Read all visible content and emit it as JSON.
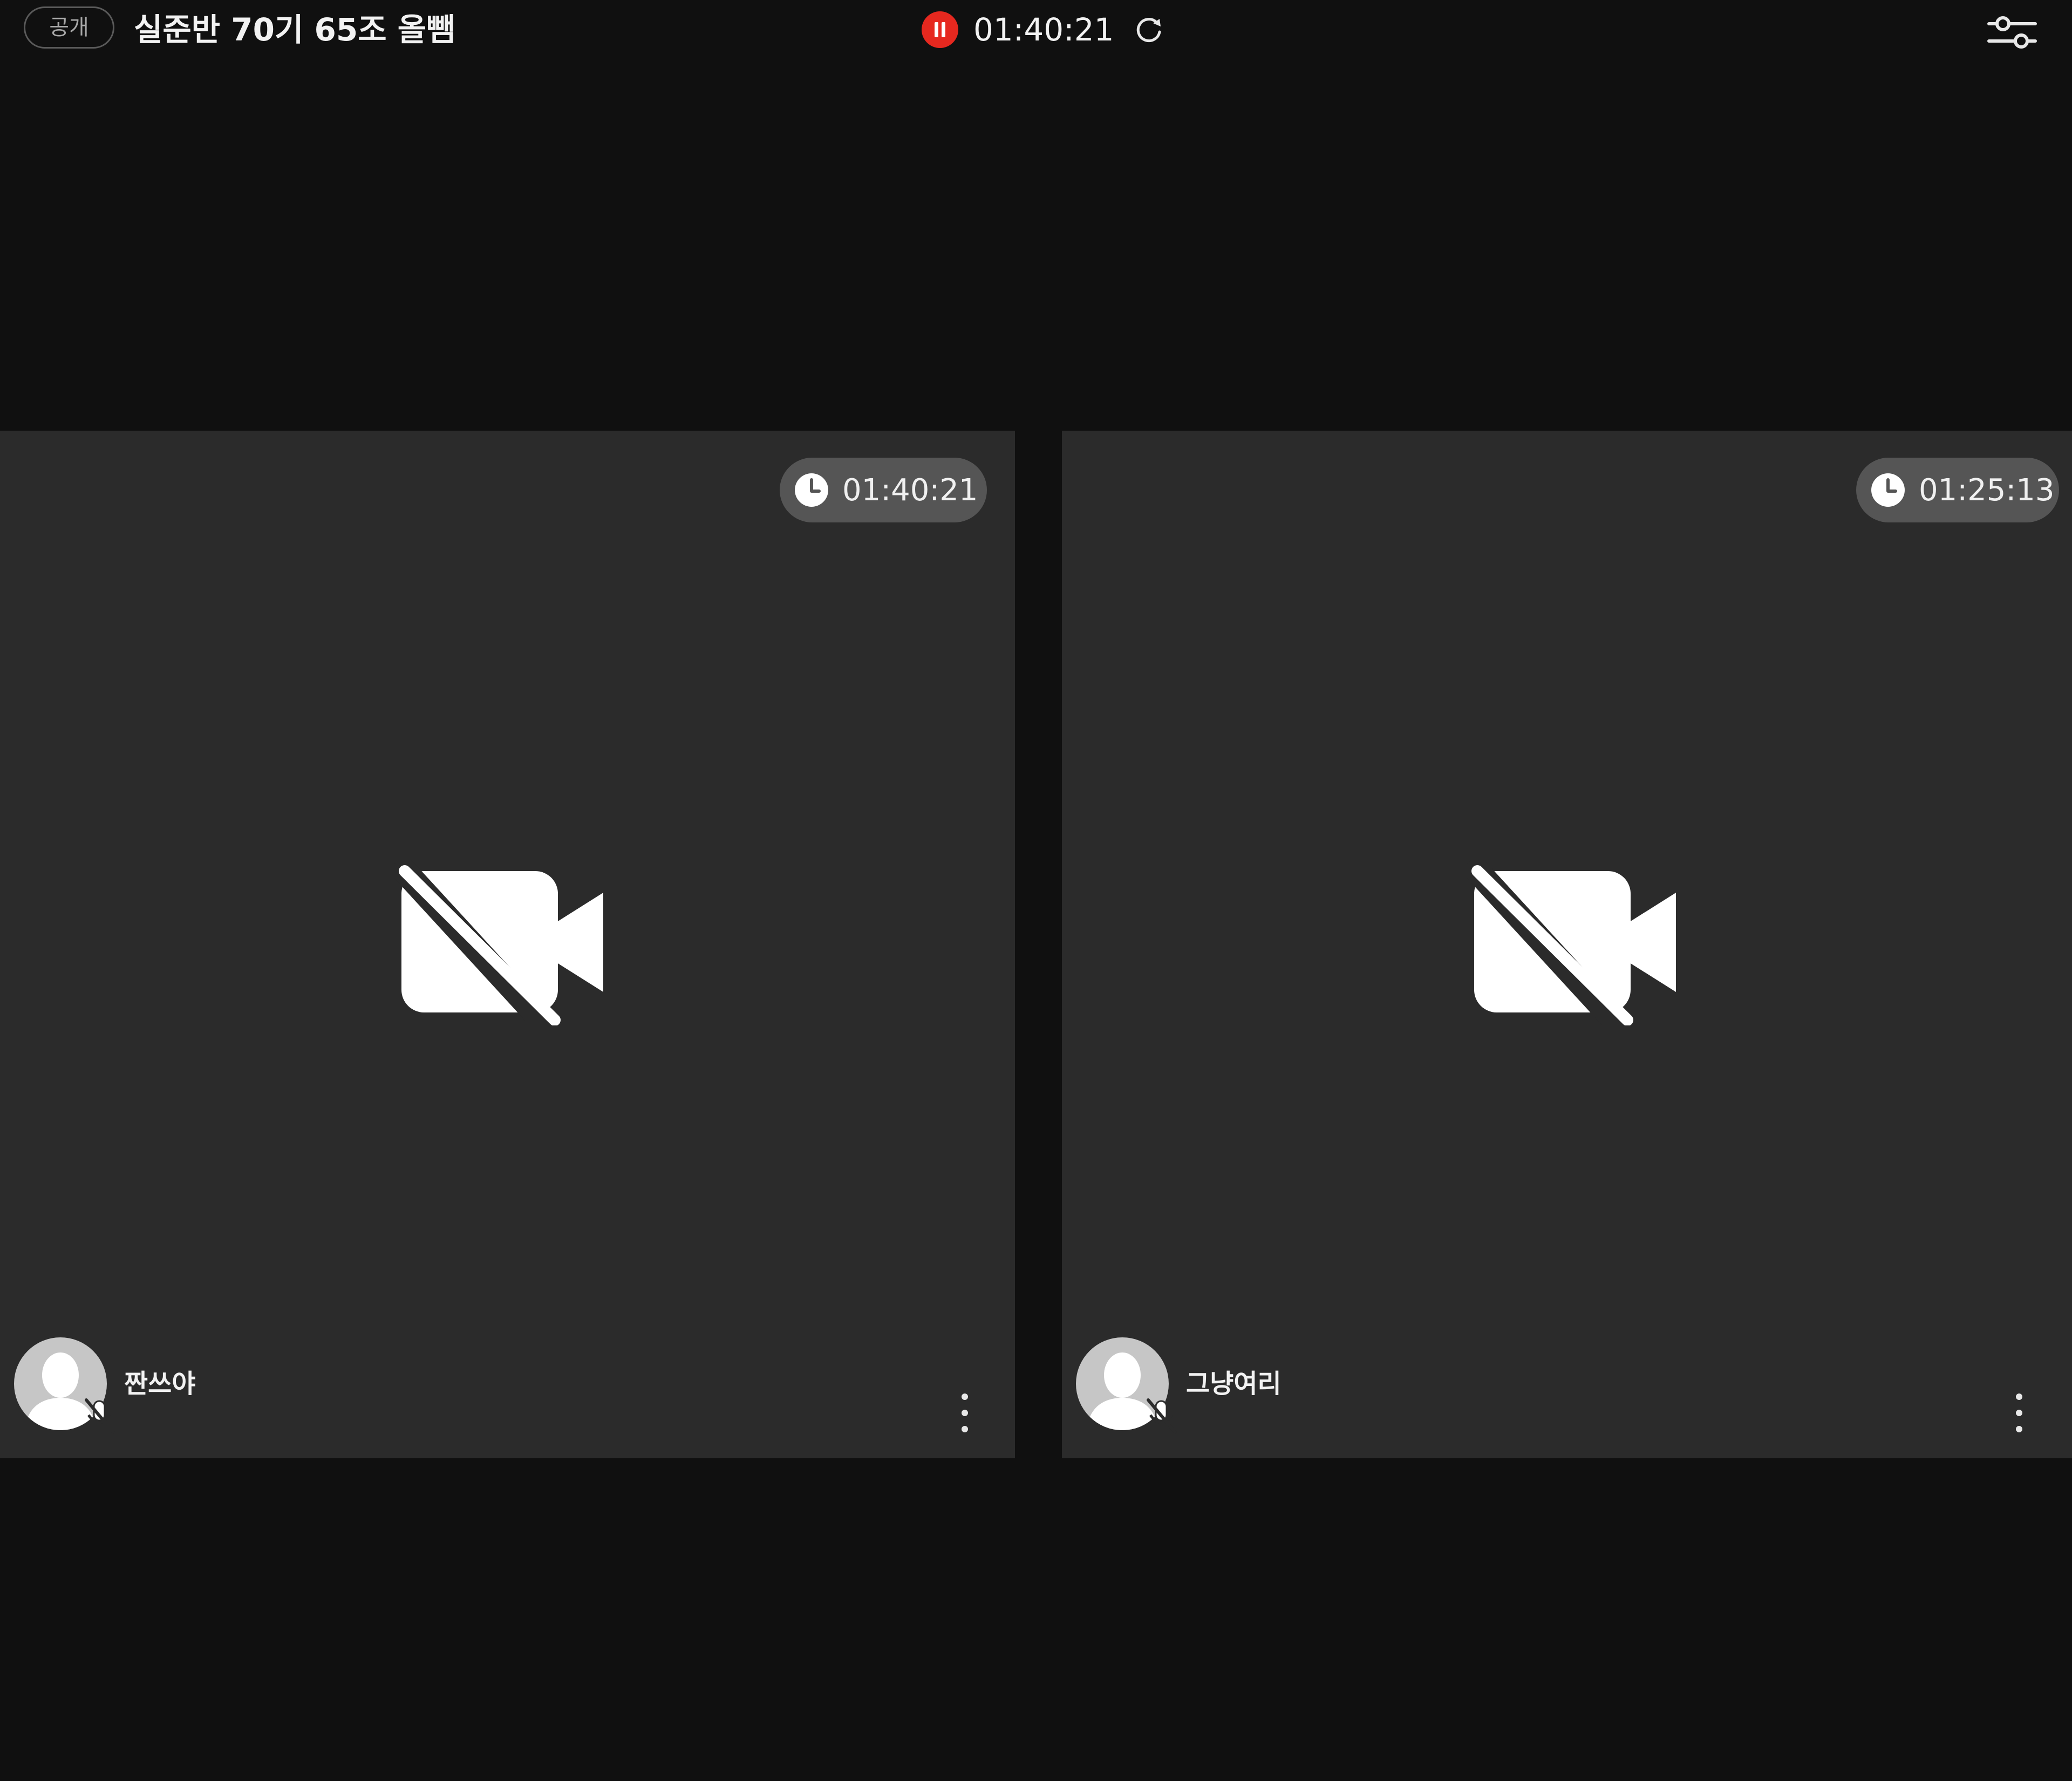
{
  "header": {
    "visibility_label": "공개",
    "room_title": "실준반 70기 65조 올뺌",
    "recording_time": "01:40:21"
  },
  "colors": {
    "background": "#101010",
    "tile_background": "#2b2b2b",
    "recording_red": "#e6281f",
    "timer_pill": "#555555"
  },
  "participants": [
    {
      "name": "짠쓰야",
      "timer": "01:40:21",
      "camera": "off",
      "microphone": "off"
    },
    {
      "name": "그냥여리",
      "timer": "01:25:13",
      "camera": "off",
      "microphone": "off"
    }
  ],
  "icons": {
    "recording": "pause-icon",
    "refresh": "refresh-icon",
    "settings": "sliders-icon",
    "timer": "clock-icon",
    "camera": "video-off-icon",
    "microphone": "mic-off-icon",
    "menu": "more-vertical-icon"
  }
}
